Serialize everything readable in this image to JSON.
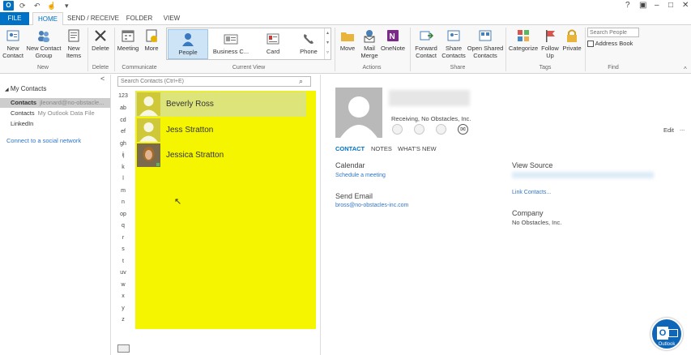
{
  "window": {
    "app_icon": "O",
    "controls": [
      "?",
      "▣",
      "–",
      "□",
      "✕"
    ]
  },
  "tabs": [
    "FILE",
    "HOME",
    "SEND / RECEIVE",
    "FOLDER",
    "VIEW"
  ],
  "ribbon": {
    "new": {
      "new_contact": "New Contact",
      "new_contact_group": "New Contact Group",
      "new_items": "New Items",
      "label": "New"
    },
    "delete": {
      "delete": "Delete",
      "label": "Delete"
    },
    "communicate": {
      "meeting": "Meeting",
      "more": "More",
      "label": "Communicate"
    },
    "current_view": {
      "items": [
        "People",
        "Business C...",
        "Card",
        "Phone"
      ],
      "label": "Current View"
    },
    "actions": {
      "move": "Move",
      "mail_merge": "Mail Merge",
      "onenote": "OneNote",
      "label": "Actions"
    },
    "share": {
      "forward_contact": "Forward Contact",
      "share_contacts": "Share Contacts",
      "open_shared_contacts": "Open Shared Contacts",
      "label": "Share"
    },
    "tags": {
      "categorize": "Categorize",
      "follow_up": "Follow Up",
      "private": "Private",
      "label": "Tags"
    },
    "find": {
      "search_placeholder": "Search People",
      "address_book": "Address Book",
      "label": "Find"
    }
  },
  "nav": {
    "header": "My Contacts",
    "items": [
      {
        "label": "Contacts",
        "sub": "jleonard@no-obstacle..."
      },
      {
        "label": "Contacts",
        "sub": "My Outlook Data File"
      },
      {
        "label": "LinkedIn",
        "sub": ""
      }
    ],
    "social": "Connect to a social network",
    "collapse": "<"
  },
  "list": {
    "search_placeholder": "Search Contacts (Ctrl+E)",
    "alphabet": [
      "123",
      "ab",
      "cd",
      "ef",
      "gh",
      "ij",
      "k",
      "l",
      "m",
      "n",
      "op",
      "q",
      "r",
      "s",
      "t",
      "uv",
      "w",
      "x",
      "y",
      "z"
    ],
    "contacts": [
      "Beverly Ross",
      "Jess Stratton",
      "Jessica Stratton"
    ]
  },
  "reading": {
    "company_line": "Receiving, No Obstacles, Inc.",
    "tabs": [
      "CONTACT",
      "NOTES",
      "WHAT'S NEW"
    ],
    "edit": "Edit",
    "more": "...",
    "calendar_head": "Calendar",
    "schedule_link": "Schedule a meeting",
    "send_email_head": "Send Email",
    "email_link": "bross@no-obstacles-inc.com",
    "view_source_head": "View Source",
    "link_contacts": "Link Contacts...",
    "company_head": "Company",
    "company_value": "No Obstacles, Inc."
  },
  "badge": {
    "letter": "O",
    "label": "Outlook"
  }
}
